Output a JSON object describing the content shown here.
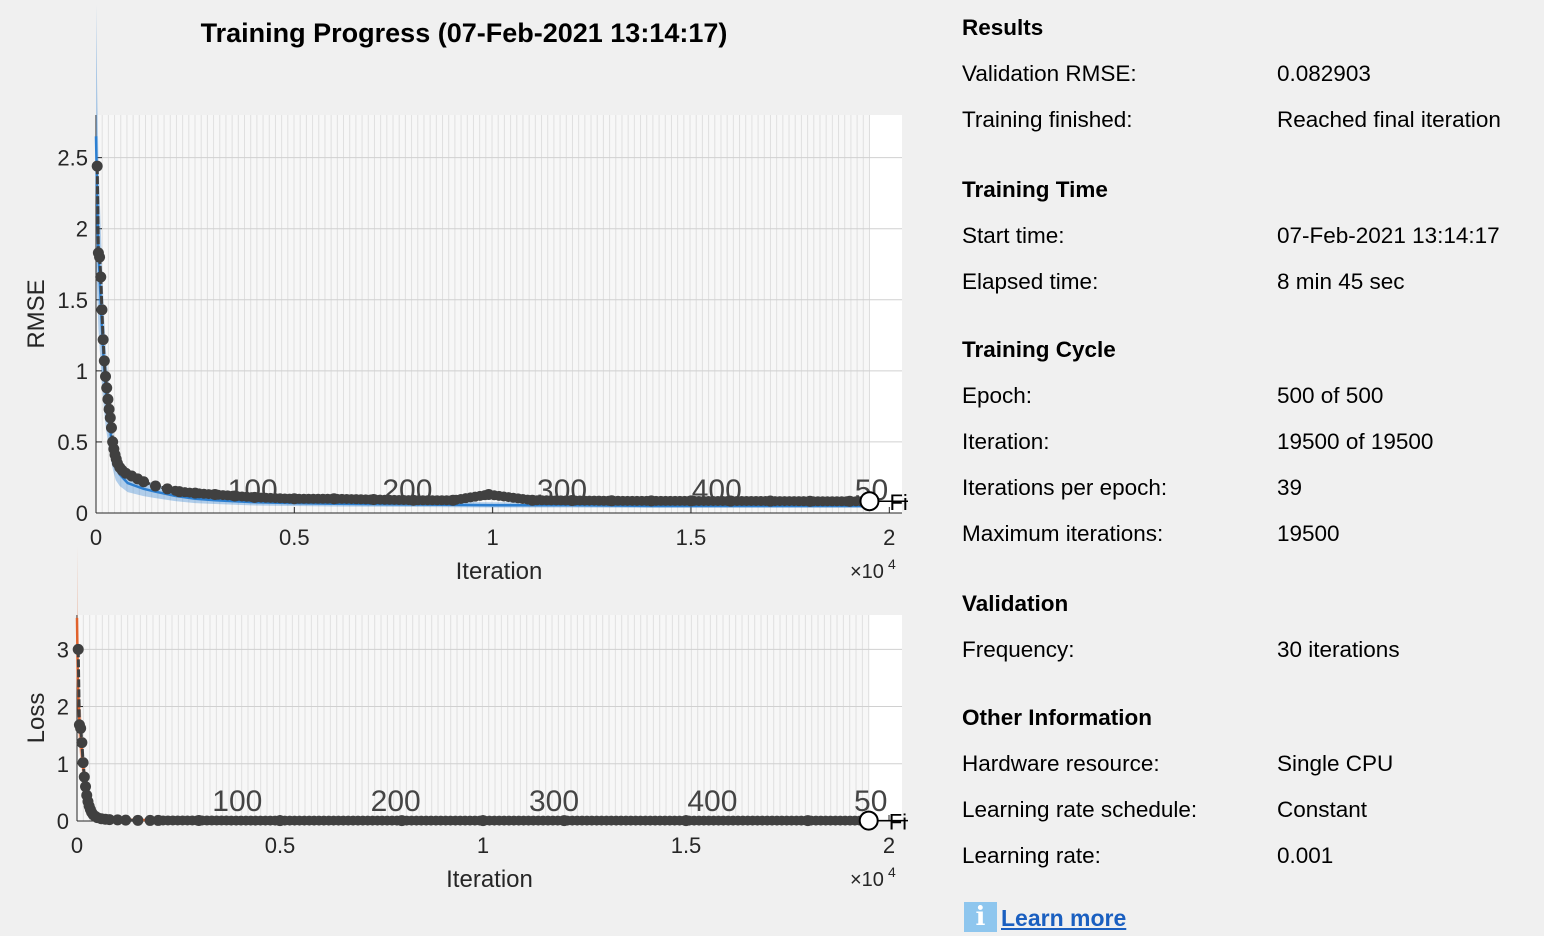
{
  "title": "Training Progress (07-Feb-2021 13:14:17)",
  "colors": {
    "background": "#f0f0f0",
    "training_rmse": "#2c7fd1",
    "training_loss": "#e0622c",
    "validation": "#404040",
    "link": "#1a5fc0",
    "info_icon": "#8ec6ee"
  },
  "chart_data": [
    {
      "type": "line",
      "name": "rmse-plot",
      "ylabel": "RMSE",
      "xlabel": "Iteration",
      "x_exponent_label": "×10",
      "x_exponent_power": "4",
      "xlim": [
        0,
        20320
      ],
      "ylim": [
        0,
        2.8
      ],
      "xtick_values": [
        0,
        5000,
        10000,
        15000,
        20000
      ],
      "xtick_labels": [
        "0",
        "0.5",
        "1",
        "1.5",
        "2"
      ],
      "ytick_values": [
        0,
        0.5,
        1,
        1.5,
        2,
        2.5
      ],
      "ytick_labels": [
        "0",
        "0.5",
        "1",
        "1.5",
        "2",
        "2.5"
      ],
      "epoch_markers": [
        {
          "label": "100",
          "x": 3900
        },
        {
          "label": "200",
          "x": 7800
        },
        {
          "label": "300",
          "x": 11700
        },
        {
          "label": "400",
          "x": 15600
        },
        {
          "label": "50",
          "x": 19500
        }
      ],
      "final_label": "Fi",
      "series": [
        {
          "role": "training",
          "x": [
            0,
            30,
            60,
            100,
            150,
            200,
            250,
            300,
            350,
            400,
            450,
            500,
            600,
            700,
            800,
            1000,
            1200,
            1500,
            2000,
            2500,
            3000,
            4000,
            5000,
            6000,
            8000,
            10000,
            12000,
            14000,
            16000,
            18000,
            19500
          ],
          "y": [
            2.65,
            2.2,
            1.85,
            1.6,
            1.3,
            1.05,
            0.85,
            0.72,
            0.6,
            0.48,
            0.4,
            0.33,
            0.27,
            0.24,
            0.21,
            0.19,
            0.17,
            0.15,
            0.12,
            0.1,
            0.09,
            0.075,
            0.07,
            0.065,
            0.06,
            0.055,
            0.055,
            0.05,
            0.05,
            0.05,
            0.05
          ]
        },
        {
          "role": "validation",
          "x": [
            30,
            60,
            90,
            120,
            150,
            180,
            210,
            240,
            270,
            300,
            330,
            360,
            390,
            420,
            450,
            480,
            510,
            540,
            600,
            660,
            750,
            900,
            1050,
            1200,
            1500,
            1800,
            2100,
            2500,
            3000,
            3500,
            4000,
            5000,
            6000,
            7000,
            8000,
            9000,
            9900,
            11000,
            12000,
            13000,
            14000,
            15000,
            16000,
            17000,
            18000,
            19000,
            19500
          ],
          "y": [
            2.44,
            1.83,
            1.8,
            1.66,
            1.43,
            1.22,
            1.07,
            0.96,
            0.88,
            0.8,
            0.73,
            0.67,
            0.6,
            0.5,
            0.45,
            0.41,
            0.38,
            0.35,
            0.32,
            0.3,
            0.28,
            0.26,
            0.24,
            0.22,
            0.19,
            0.17,
            0.15,
            0.14,
            0.13,
            0.12,
            0.11,
            0.1,
            0.1,
            0.095,
            0.09,
            0.09,
            0.13,
            0.09,
            0.088,
            0.086,
            0.085,
            0.085,
            0.084,
            0.084,
            0.083,
            0.083,
            0.083
          ]
        }
      ]
    },
    {
      "type": "line",
      "name": "loss-plot",
      "ylabel": "Loss",
      "xlabel": "Iteration",
      "x_exponent_label": "×10",
      "x_exponent_power": "4",
      "xlim": [
        0,
        20320
      ],
      "ylim": [
        0,
        3.6
      ],
      "xtick_values": [
        0,
        5000,
        10000,
        15000,
        20000
      ],
      "xtick_labels": [
        "0",
        "0.5",
        "1",
        "1.5",
        "2"
      ],
      "ytick_values": [
        0,
        1,
        2,
        3
      ],
      "ytick_labels": [
        "0",
        "1",
        "2",
        "3"
      ],
      "epoch_markers": [
        {
          "label": "100",
          "x": 3900
        },
        {
          "label": "200",
          "x": 7800
        },
        {
          "label": "300",
          "x": 11700
        },
        {
          "label": "400",
          "x": 15600
        },
        {
          "label": "50",
          "x": 19500
        }
      ],
      "final_label": "Fi",
      "series": [
        {
          "role": "training",
          "x": [
            0,
            20,
            40,
            60,
            90,
            120,
            150,
            200,
            250,
            300,
            400,
            500,
            700,
            1000,
            1500,
            2000,
            3000,
            5000,
            10000,
            15000,
            19500
          ],
          "y": [
            3.55,
            2.5,
            2.0,
            1.75,
            1.5,
            1.2,
            0.95,
            0.7,
            0.5,
            0.35,
            0.2,
            0.12,
            0.06,
            0.03,
            0.02,
            0.012,
            0.008,
            0.005,
            0.004,
            0.003,
            0.003
          ]
        },
        {
          "role": "validation",
          "x": [
            30,
            60,
            90,
            120,
            150,
            180,
            210,
            240,
            270,
            300,
            330,
            360,
            400,
            450,
            500,
            600,
            700,
            800,
            1000,
            1200,
            1500,
            1800,
            2000,
            3000,
            5000,
            8000,
            10000,
            12000,
            15000,
            18000,
            19500
          ],
          "y": [
            3.0,
            1.68,
            1.62,
            1.37,
            1.02,
            0.77,
            0.6,
            0.45,
            0.34,
            0.26,
            0.2,
            0.15,
            0.11,
            0.08,
            0.06,
            0.04,
            0.03,
            0.025,
            0.02,
            0.015,
            0.012,
            0.01,
            0.01,
            0.008,
            0.007,
            0.007,
            0.007,
            0.007,
            0.007,
            0.007,
            0.007
          ]
        }
      ]
    }
  ],
  "info": {
    "results": {
      "heading": "Results",
      "rows": [
        {
          "label": "Validation RMSE:",
          "value": "0.082903"
        },
        {
          "label": "Training finished:",
          "value": "Reached final iteration"
        }
      ]
    },
    "training_time": {
      "heading": "Training Time",
      "rows": [
        {
          "label": "Start time:",
          "value": "07-Feb-2021 13:14:17"
        },
        {
          "label": "Elapsed time:",
          "value": "8 min 45 sec"
        }
      ]
    },
    "training_cycle": {
      "heading": "Training Cycle",
      "rows": [
        {
          "label": "Epoch:",
          "value": "500 of 500"
        },
        {
          "label": "Iteration:",
          "value": "19500 of 19500"
        },
        {
          "label": "Iterations per epoch:",
          "value": "39"
        },
        {
          "label": "Maximum iterations:",
          "value": "19500"
        }
      ]
    },
    "validation": {
      "heading": "Validation",
      "rows": [
        {
          "label": "Frequency:",
          "value": "30 iterations"
        }
      ]
    },
    "other_information": {
      "heading": "Other Information",
      "rows": [
        {
          "label": "Hardware resource:",
          "value": "Single CPU"
        },
        {
          "label": "Learning rate schedule:",
          "value": "Constant"
        },
        {
          "label": "Learning rate:",
          "value": "0.001"
        }
      ]
    }
  },
  "learn_more": {
    "icon": "info-icon",
    "icon_glyph": "i",
    "label": "Learn more"
  }
}
